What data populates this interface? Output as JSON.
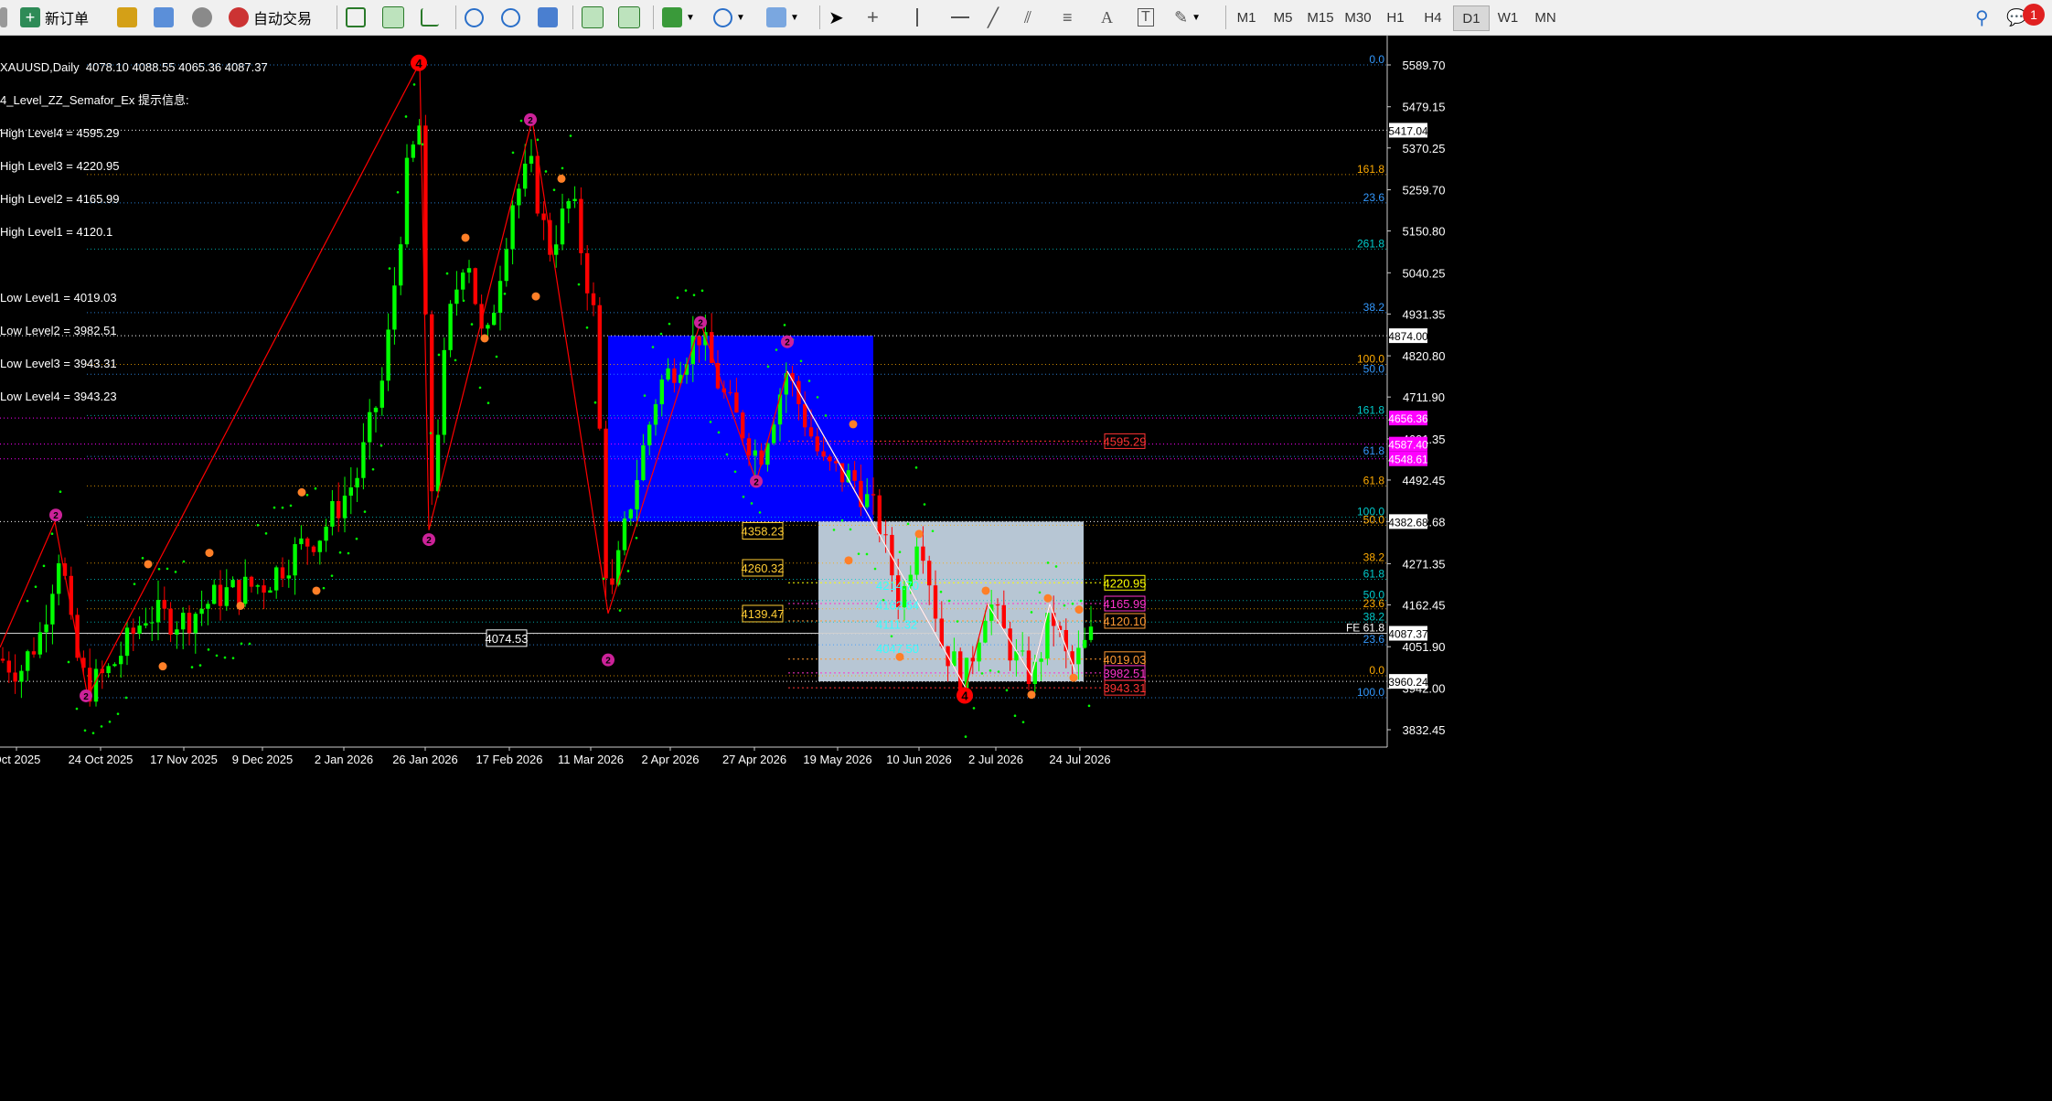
{
  "toolbar": {
    "new_order": "新订单",
    "auto_trading": "自动交易",
    "timeframes": [
      "M1",
      "M5",
      "M15",
      "M30",
      "H1",
      "H4",
      "D1",
      "W1",
      "MN"
    ],
    "active_timeframe": "D1",
    "notification_count": "1"
  },
  "chart_header": {
    "symbol_line": "XAUUSD,Daily  4078.10 4088.55 4065.36 4087.37",
    "indicator_line": "4_Level_ZZ_Semafor_Ex 提示信息:",
    "high_levels": [
      "High Level4 = 4595.29",
      "High Level3 = 4220.95",
      "High Level2 = 4165.99",
      "High Level1 = 4120.1"
    ],
    "low_levels": [
      "Low Level1 = 4019.03",
      "Low Level2 = 3982.51",
      "Low Level3 = 3943.31",
      "Low Level4 = 3943.23"
    ]
  },
  "chart_data": {
    "type": "candlestick",
    "symbol": "XAUUSD",
    "timeframe": "Daily",
    "ohlc_current": {
      "open": 4078.1,
      "high": 4088.55,
      "low": 4065.36,
      "close": 4087.37
    },
    "price_axis_ticks": [
      5589.7,
      5479.15,
      5370.25,
      5259.7,
      5150.8,
      5040.25,
      4931.35,
      4820.8,
      4711.9,
      4601.35,
      4492.45,
      4382.68,
      4271.35,
      4162.45,
      4051.9,
      3942.0,
      3832.45
    ],
    "price_axis_markers": [
      {
        "label": "5417.04",
        "value": 5417.04,
        "color": "#ffffff"
      },
      {
        "label": "4874.00",
        "value": 4874.0,
        "color": "#ffffff"
      },
      {
        "label": "4656.36",
        "value": 4656.36,
        "color": "#ff00ff"
      },
      {
        "label": "4587.40",
        "value": 4587.4,
        "color": "#ff00ff"
      },
      {
        "label": "4548.61",
        "value": 4548.61,
        "color": "#ff00ff"
      },
      {
        "label": "4382.68",
        "value": 4382.68,
        "color": "#ffffff"
      },
      {
        "label": "4087.37",
        "value": 4087.37,
        "color": "#ffffff"
      },
      {
        "label": "3960.24",
        "value": 3960.24,
        "color": "#ffffff"
      }
    ],
    "date_axis_ticks": [
      "Oct 2025",
      "24 Oct 2025",
      "17 Nov 2025",
      "9 Dec 2025",
      "2 Jan 2026",
      "26 Jan 2026",
      "17 Feb 2026",
      "11 Mar 2026",
      "2 Apr 2026",
      "27 Apr 2026",
      "19 May 2026",
      "10 Jun 2026",
      "2 Jul 2026",
      "24 Jul 2026"
    ],
    "price_boxes": [
      {
        "label": "4358.23",
        "value": 4358.23,
        "color": "#ffcc33"
      },
      {
        "label": "4260.32",
        "value": 4260.32,
        "color": "#ffcc33"
      },
      {
        "label": "4139.47",
        "value": 4139.47,
        "color": "#ffcc33"
      },
      {
        "label": "4074.53",
        "value": 4074.53,
        "color": "#ffffff"
      }
    ],
    "inner_labels": [
      {
        "label": "4214.70",
        "value": 4214.7
      },
      {
        "label": "4162.64",
        "value": 4162.64
      },
      {
        "label": "4111.32",
        "value": 4111.32
      },
      {
        "label": "4047.50",
        "value": 4047.5
      }
    ],
    "semafor_levels": [
      {
        "label": "4595.29",
        "value": 4595.29,
        "color": "#ff3333"
      },
      {
        "label": "4220.95",
        "value": 4220.95,
        "color": "#ffff00"
      },
      {
        "label": "4165.99",
        "value": 4165.99,
        "color": "#ff33cc"
      },
      {
        "label": "4120.10",
        "value": 4120.1,
        "color": "#ff9933"
      },
      {
        "label": "4019.03",
        "value": 4019.03,
        "color": "#ff9933"
      },
      {
        "label": "3982.51",
        "value": 3982.51,
        "color": "#ff33cc"
      },
      {
        "label": "3943.31",
        "value": 3943.31,
        "color": "#ff3333"
      }
    ],
    "fibo_right_labels": [
      {
        "label": "0.0",
        "value": 5589.7,
        "color": "#3399ff"
      },
      {
        "label": "161.8",
        "value": 5300,
        "color": "#ffaa00"
      },
      {
        "label": "23.6",
        "value": 5225,
        "color": "#3399ff"
      },
      {
        "label": "261.8",
        "value": 5103,
        "color": "#00cccc"
      },
      {
        "label": "38.2",
        "value": 4935,
        "color": "#3399ff"
      },
      {
        "label": "100.0",
        "value": 4798,
        "color": "#ffaa00"
      },
      {
        "label": "50.0",
        "value": 4772,
        "color": "#3399ff"
      },
      {
        "label": "161.8",
        "value": 4663,
        "color": "#00cccc"
      },
      {
        "label": "61.8",
        "value": 4555,
        "color": "#3399ff"
      },
      {
        "label": "61.8",
        "value": 4477,
        "color": "#ffaa00"
      },
      {
        "label": "100.0",
        "value": 4394,
        "color": "#00cccc"
      },
      {
        "label": "50.0",
        "value": 4373,
        "color": "#ffaa00"
      },
      {
        "label": "38.2",
        "value": 4273,
        "color": "#ffaa00"
      },
      {
        "label": "61.8",
        "value": 4230,
        "color": "#00cccc"
      },
      {
        "label": "50.0",
        "value": 4174,
        "color": "#00cccc"
      },
      {
        "label": "23.6",
        "value": 4152,
        "color": "#ffaa00"
      },
      {
        "label": "38.2",
        "value": 4117,
        "color": "#00cccc"
      },
      {
        "label": "FE 61.8",
        "value": 4087,
        "color": "#ffffff"
      },
      {
        "label": "23.6",
        "value": 4057,
        "color": "#3399ff"
      },
      {
        "label": "0.0",
        "value": 3975,
        "color": "#ffaa00"
      },
      {
        "label": "100.0",
        "value": 3917,
        "color": "#3399ff"
      }
    ],
    "zigzag_markers": [
      {
        "label": "4",
        "type": "major",
        "value": 5595
      },
      {
        "label": "2",
        "type": "mid",
        "value": 5445
      },
      {
        "label": "2",
        "type": "mid",
        "value": 4909
      },
      {
        "label": "2",
        "type": "mid",
        "value": 4858
      },
      {
        "label": "2",
        "type": "mid",
        "value": 4400
      },
      {
        "label": "2",
        "type": "mid",
        "value": 4330
      },
      {
        "label": "2",
        "type": "mid",
        "value": 4489
      },
      {
        "label": "2",
        "type": "mid",
        "value": 4017
      },
      {
        "label": "2",
        "type": "mid",
        "value": 3922
      },
      {
        "label": "4",
        "type": "major",
        "value": 3923
      },
      {
        "label": "1",
        "type": "minor",
        "value": 0
      }
    ],
    "candles_approx": [
      {
        "date": "Oct 2025",
        "close": 4020
      },
      {
        "date": "24 Oct 2025",
        "close": 3960
      },
      {
        "date": "17 Nov 2025",
        "close": 4100
      },
      {
        "date": "9 Dec 2025",
        "close": 4230
      },
      {
        "date": "2 Jan 2026",
        "close": 4400
      },
      {
        "date": "26 Jan 2026",
        "close": 5420
      },
      {
        "date": "17 Feb 2026",
        "close": 5250
      },
      {
        "date": "11 Mar 2026",
        "close": 4140
      },
      {
        "date": "2 Apr 2026",
        "close": 4760
      },
      {
        "date": "27 Apr 2026",
        "close": 4540
      },
      {
        "date": "19 May 2026",
        "close": 4560
      },
      {
        "date": "10 Jun 2026",
        "close": 4230
      },
      {
        "date": "2 Jul 2026",
        "close": 4040
      },
      {
        "date": "24 Jul 2026",
        "close": 4087.37
      }
    ],
    "colors": {
      "bull": "#00ff00",
      "bear": "#ff0000",
      "blue_box": "#0000ff",
      "gray_box": "#b7c6d4",
      "zigzag": "#ff0000"
    }
  }
}
